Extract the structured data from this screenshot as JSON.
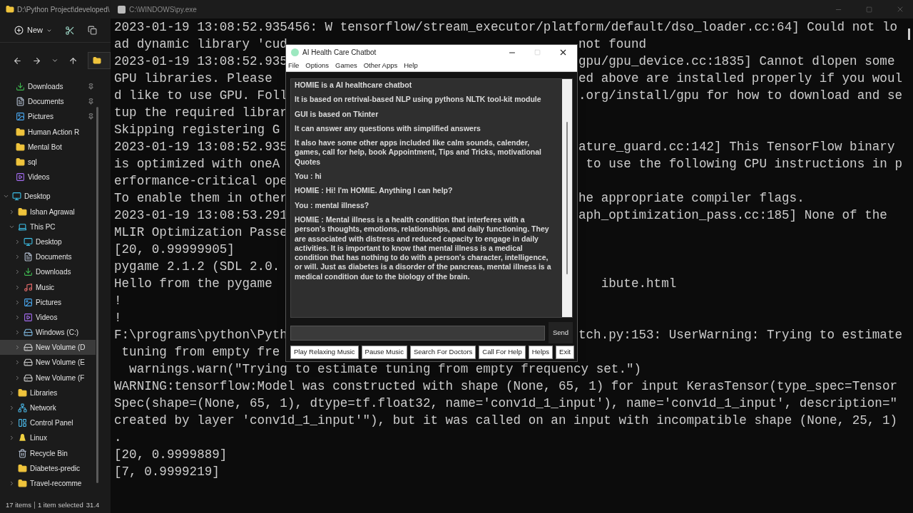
{
  "explorer": {
    "title": "D:\\Python Project\\developed\\",
    "toolbar": {
      "new_label": "New"
    },
    "quick_access": [
      {
        "label": "Downloads",
        "kind": "download",
        "pinned": true,
        "selected": false
      },
      {
        "label": "Documents",
        "kind": "document",
        "pinned": true,
        "selected": false
      },
      {
        "label": "Pictures",
        "kind": "picture",
        "pinned": true,
        "selected": false
      },
      {
        "label": "Human Action R",
        "kind": "folder",
        "pinned": false,
        "selected": false
      },
      {
        "label": "Mental Bot",
        "kind": "folder",
        "pinned": false,
        "selected": false
      },
      {
        "label": "sql",
        "kind": "folder",
        "pinned": false,
        "selected": false
      },
      {
        "label": "Videos",
        "kind": "video",
        "pinned": false,
        "selected": false
      }
    ],
    "tree": [
      {
        "label": "Desktop",
        "kind": "desktop",
        "expanded": true,
        "selected": false,
        "children": [
          {
            "label": "Ishan Agrawal",
            "kind": "folder",
            "expanded": false,
            "selected": false
          },
          {
            "label": "This PC",
            "kind": "pc",
            "expanded": true,
            "selected": false,
            "children": [
              {
                "label": "Desktop",
                "kind": "desktop",
                "expanded": false,
                "selected": false
              },
              {
                "label": "Documents",
                "kind": "document",
                "expanded": false,
                "selected": false
              },
              {
                "label": "Downloads",
                "kind": "download",
                "expanded": false,
                "selected": false
              },
              {
                "label": "Music",
                "kind": "music",
                "expanded": false,
                "selected": false
              },
              {
                "label": "Pictures",
                "kind": "picture",
                "expanded": false,
                "selected": false
              },
              {
                "label": "Videos",
                "kind": "video",
                "expanded": false,
                "selected": false
              },
              {
                "label": "Windows (C:)",
                "kind": "system-drive",
                "expanded": false,
                "selected": false
              },
              {
                "label": "New Volume (D",
                "kind": "drive",
                "expanded": false,
                "selected": true
              },
              {
                "label": "New Volume (E",
                "kind": "drive",
                "expanded": false,
                "selected": false
              },
              {
                "label": "New Volume (F",
                "kind": "drive",
                "expanded": false,
                "selected": false
              }
            ]
          },
          {
            "label": "Libraries",
            "kind": "folder",
            "expanded": false,
            "selected": false
          },
          {
            "label": "Network",
            "kind": "network",
            "expanded": false,
            "selected": false
          },
          {
            "label": "Control Panel",
            "kind": "control",
            "expanded": false,
            "selected": false
          },
          {
            "label": "Linux",
            "kind": "linux",
            "expanded": false,
            "selected": false
          },
          {
            "label": "Recycle Bin",
            "kind": "recycle",
            "selected": false
          },
          {
            "label": "Diabetes-predic",
            "kind": "folder",
            "selected": false
          },
          {
            "label": "Travel-recomme",
            "kind": "folder",
            "expanded": false,
            "selected": false
          }
        ]
      }
    ],
    "status": {
      "items": "17 items",
      "selection": "1 item selected",
      "size": "31.4"
    }
  },
  "console": {
    "title": "C:\\WINDOWS\\py.exe",
    "lines": [
      {
        "left": "2023-01-19 13:08:52.935456: W tensorflow/stream_executor/platform/default/dso_loader.cc:64] Could not lo"
      },
      {
        "left": "ad dynamic library 'cud",
        "right": "not found"
      },
      {
        "left": "2023-01-19 13:08:52.935",
        "right": "gpu/gpu_device.cc:1835] Cannot dlopen some"
      },
      {
        "left": "GPU libraries. Please",
        "right": "ed above are installed properly if you woul"
      },
      {
        "left": "d like to use GPU. Foll",
        "right": ".org/install/gpu for how to download and se"
      },
      {
        "left": "tup the required librar"
      },
      {
        "left": "Skipping registering G"
      },
      {
        "left": "2023-01-19 13:08:52.935",
        "right": "ature_guard.cc:142] This TensorFlow binary"
      },
      {
        "left": "is optimized with oneA",
        "right": " to use the following CPU instructions in p"
      },
      {
        "left": "erformance-critical ope"
      },
      {
        "left": "To enable them in other",
        "right": "he appropriate compiler flags."
      },
      {
        "left": "2023-01-19 13:08:53.291",
        "right": "aph_optimization_pass.cc:185] None of the"
      },
      {
        "left": "MLIR Optimization Passe"
      },
      {
        "left": "[20, 0.99999905]"
      },
      {
        "left": "pygame 2.1.2 (SDL 2.0."
      },
      {
        "left": "Hello from the pygame",
        "right": "   ibute.html"
      },
      {
        "left": "!"
      },
      {
        "left": "!"
      },
      {
        "left": "F:\\programs\\python\\Pyth",
        "right": "tch.py:153: UserWarning: Trying to estimate"
      },
      {
        "left": " tuning from empty fre"
      },
      {
        "left": "  warnings.warn(\"Trying to estimate tuning from empty frequency set.\")"
      },
      {
        "left": "WARNING:tensorflow:Model was constructed with shape (None, 65, 1) for input KerasTensor(type_spec=Tensor"
      },
      {
        "left": "Spec(shape=(None, 65, 1), dtype=tf.float32, name='conv1d_1_input'), name='conv1d_1_input', description=\""
      },
      {
        "left": "created by layer 'conv1d_1_input'\"), but it was called on an input with incompatible shape (None, 25, 1)"
      },
      {
        "left": "."
      },
      {
        "left": "[20, 0.9999889]"
      },
      {
        "left": "[7, 0.9999219]"
      }
    ]
  },
  "chatbot": {
    "title": "AI Health Care Chatbot",
    "menu": [
      "File",
      "Options",
      "Games",
      "Other Apps",
      "Help"
    ],
    "messages": [
      "HOMIE is a AI healthcare chatbot",
      "It is based on retrival-based NLP using pythons NLTK tool-kit module",
      "GUI is based on Tkinter",
      "It can answer any questions with simplified answers",
      "It also have some other apps included like calm sounds, calender, games, call for help, book Appointment, Tips and Tricks, motivational Quotes",
      "You : hi",
      "HOMIE :  Hi! I'm HOMIE. Anything I can help?",
      "You : mental illness?",
      "HOMIE :  Mental illness is a health condition that interferes with a person's thoughts, emotions, relationships, and daily functioning. They are associated with distress and reduced capacity to engage in daily activities. It is important to know that mental illness is a medical condition that has nothing to do with a person's character, intelligence, or will. Just as diabetes is a disorder of the pancreas, mental illness is a medical condition due to the biology of the brain."
    ],
    "send": "Send",
    "buttons": [
      "Play Relaxing Music",
      "Pause Music",
      "Search For Doctors",
      "Call For Help",
      "Helps",
      "Exit"
    ]
  }
}
